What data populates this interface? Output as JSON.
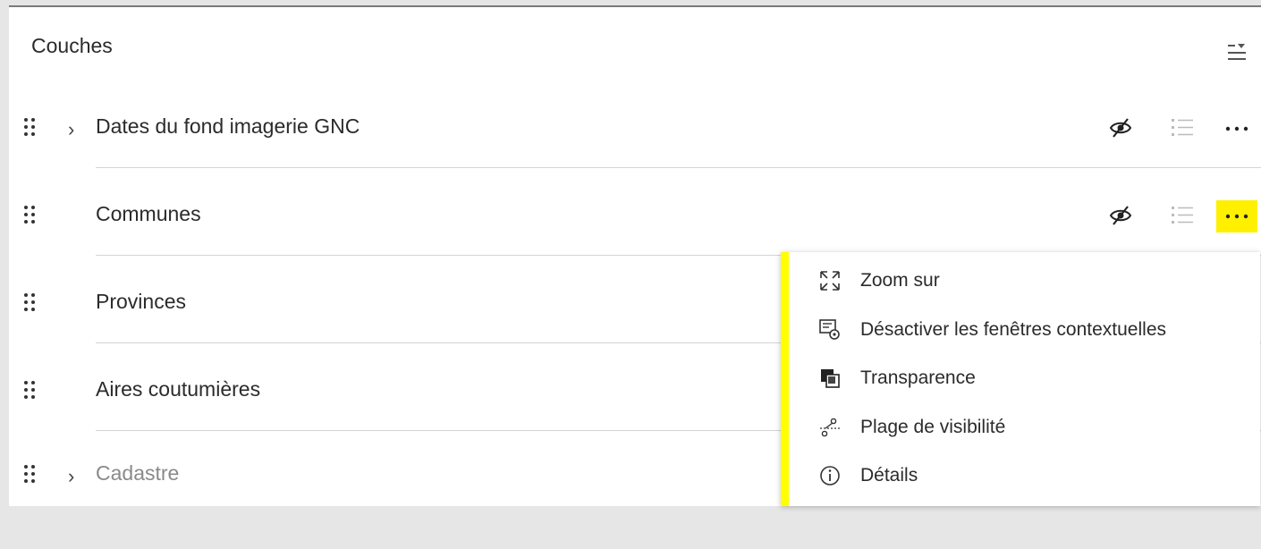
{
  "panel": {
    "title": "Couches"
  },
  "layers": [
    {
      "label": "Dates du fond imagerie GNC",
      "expandable": true,
      "dimmed": false,
      "show_actions": true,
      "more_highlighted": false
    },
    {
      "label": "Communes",
      "expandable": false,
      "dimmed": false,
      "show_actions": true,
      "more_highlighted": true
    },
    {
      "label": "Provinces",
      "expandable": false,
      "dimmed": false,
      "show_actions": false
    },
    {
      "label": "Aires coutumières",
      "expandable": false,
      "dimmed": false,
      "show_actions": false
    },
    {
      "label": "Cadastre",
      "expandable": true,
      "dimmed": true,
      "show_actions": false
    }
  ],
  "context_menu": {
    "items": [
      {
        "label": "Zoom sur",
        "icon": "zoom-to-icon"
      },
      {
        "label": "Désactiver les fenêtres contextuelles",
        "icon": "popup-disable-icon"
      },
      {
        "label": "Transparence",
        "icon": "transparency-icon"
      },
      {
        "label": "Plage de visibilité",
        "icon": "visibility-range-icon"
      },
      {
        "label": "Détails",
        "icon": "info-icon"
      }
    ]
  },
  "colors": {
    "highlight": "#ffff00",
    "text": "#2b2b2b",
    "dim_text": "#8a8a8a"
  }
}
